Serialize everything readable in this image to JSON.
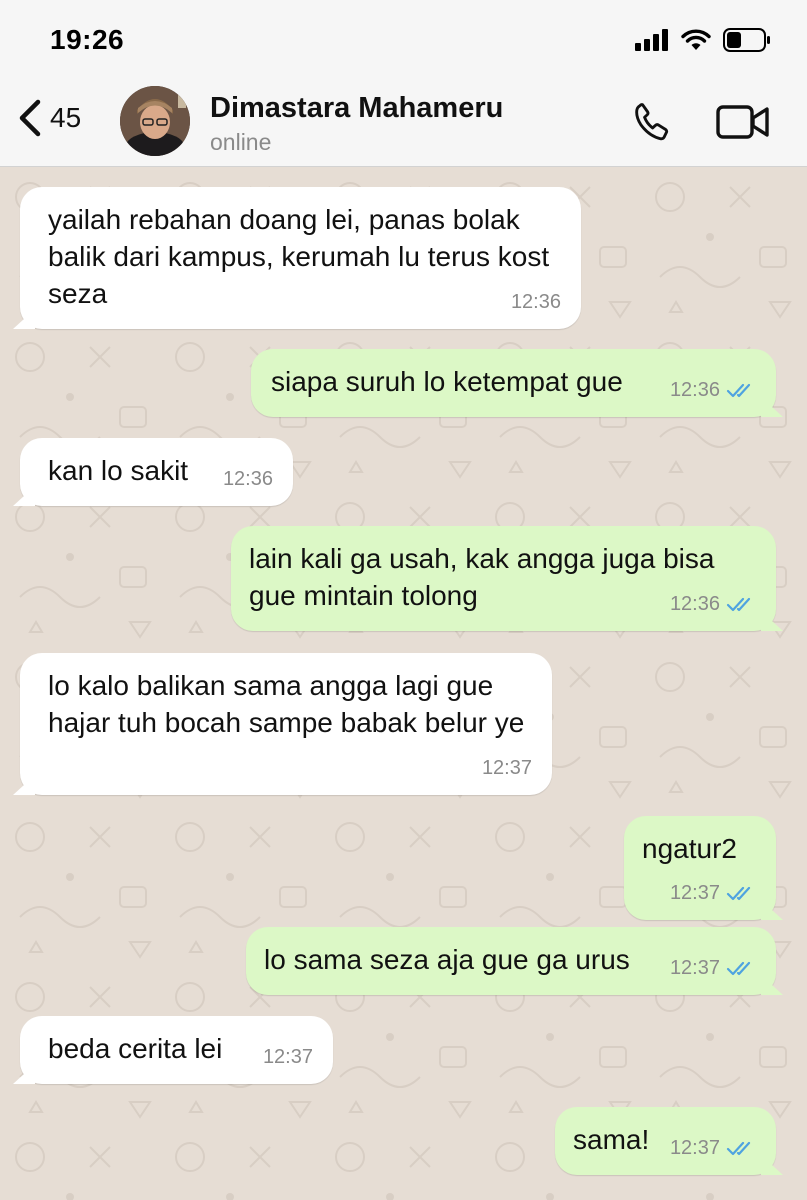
{
  "status_bar": {
    "time": "19:26"
  },
  "header": {
    "back_count": "45",
    "contact_name": "Dimastara Mahameru",
    "contact_status": "online"
  },
  "colors": {
    "incoming_bubble": "#ffffff",
    "outgoing_bubble": "#dcf8c6",
    "read_ticks": "#4fa3e0",
    "wallpaper": "#e6ddd4"
  },
  "messages": [
    {
      "direction": "in",
      "text": "yailah rebahan doang lei, panas bolak balik dari kampus, kerumah lu terus kost seza",
      "time": "12:36"
    },
    {
      "direction": "out",
      "text": "siapa suruh lo ketempat gue",
      "time": "12:36",
      "status": "read"
    },
    {
      "direction": "in",
      "text": "kan lo sakit",
      "time": "12:36"
    },
    {
      "direction": "out",
      "text": "lain kali ga usah, kak angga juga bisa gue mintain tolong",
      "time": "12:36",
      "status": "read"
    },
    {
      "direction": "in",
      "text": "lo kalo balikan sama angga lagi gue hajar tuh bocah sampe babak belur ye",
      "time": "12:37"
    },
    {
      "direction": "out",
      "text": "ngatur2",
      "time": "12:37",
      "status": "read"
    },
    {
      "direction": "out",
      "text": "lo sama seza aja gue ga urus",
      "time": "12:37",
      "status": "read"
    },
    {
      "direction": "in",
      "text": "beda cerita lei",
      "time": "12:37"
    },
    {
      "direction": "out",
      "text": "sama!",
      "time": "12:37",
      "status": "read"
    }
  ]
}
